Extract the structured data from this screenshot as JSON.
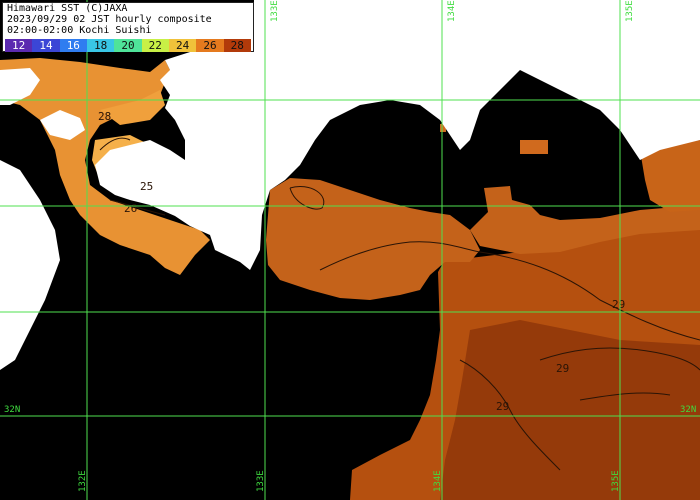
{
  "header": {
    "line1": "Himawari SST (C)JAXA",
    "line2": "2023/09/29 02 JST hourly composite",
    "line3": "02:00-02:00 Kochi Suishi"
  },
  "legend": {
    "ticks": [
      "12",
      "14",
      "16",
      "18",
      "20",
      "22",
      "24",
      "26",
      "28"
    ],
    "colors": [
      "#5b2ab0",
      "#3b46d6",
      "#2f7df0",
      "#39c6e6",
      "#4fe39a",
      "#c8f046",
      "#f0c23a",
      "#e57a1e",
      "#b23a0a"
    ]
  },
  "grid": {
    "lon_labels": [
      "132E",
      "133E",
      "134E",
      "135E"
    ],
    "lat_label": "32N"
  },
  "contours": [
    "25",
    "26",
    "28",
    "29",
    "29",
    "29"
  ],
  "colors": {
    "land": "#ffffff",
    "nodata": "#000000",
    "grid": "#4fe04f",
    "sst_warm": "#b8500e",
    "sst_orange": "#e08a2a",
    "sst_light": "#f2aa3f",
    "sst_dark": "#8f3408"
  }
}
